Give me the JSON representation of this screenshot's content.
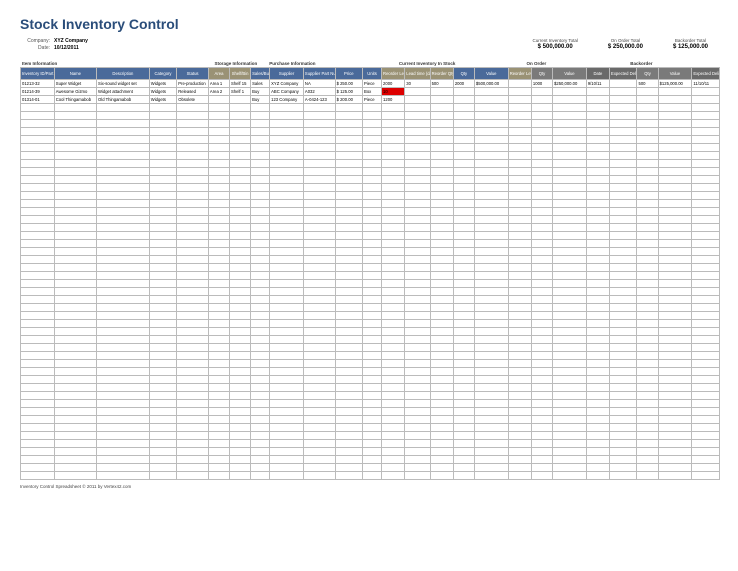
{
  "title": "Stock Inventory Control",
  "meta": {
    "company_lbl": "Company:",
    "company": "XYZ Company",
    "date_lbl": "Date:",
    "date": "10/12/2011"
  },
  "totals": {
    "inv_lbl": "Current Inventory Total",
    "inv_val": "$ 500,000.00",
    "order_lbl": "On Order Total",
    "order_val": "$ 250,000.00",
    "back_lbl": "Backorder Total",
    "back_val": "$ 125,000.00"
  },
  "sections": {
    "s1": "Item Information",
    "s2": "Storage Information",
    "s3": "Purchase Information",
    "s4": "Current Inventory In Stock",
    "s5": "On Order",
    "s6": "Backorder"
  },
  "headers": {
    "h1": "Inventory ID/Part Number",
    "h2": "Name",
    "h3": "Description",
    "h4": "Category",
    "h5": "Status",
    "h6": "Area",
    "h7": "Shelf/Bin",
    "h8": "Sales/Buy",
    "h9": "Supplier",
    "h10": "Supplier Part Number",
    "h11": "Price",
    "h12": "Units",
    "h13": "Reorder Level",
    "h14": "Lead time (days)",
    "h15": "Reorder Qty",
    "h16": "Qty",
    "h17": "Value",
    "h18": "Reorder Level",
    "h19": "Qty",
    "h20": "Value",
    "h21": "Date",
    "h22": "Expected Delivery",
    "h23": "Qty",
    "h24": "Value",
    "h25": "Expected Delivery"
  },
  "rows": [
    {
      "c1": "01213-32",
      "c2": "Super Widget",
      "c3": "Six-sound widget set",
      "c4": "Widgets",
      "c5": "Pre-production",
      "c6": "Area 1",
      "c7": "Shelf 15",
      "c8": "Sales",
      "c9": "XYZ Company",
      "c10": "NA",
      "c11": "$ 250.00",
      "c12": "Piece",
      "c13": "2000",
      "c14": "30",
      "c15": "500",
      "c16": "2000",
      "c17": "$500,000.00",
      "c18": "",
      "c19": "1000",
      "c20": "$250,000.00",
      "c21": "9/10/11",
      "c22": "",
      "c23": "500",
      "c24": "$125,000.00",
      "c25": "11/10/11"
    },
    {
      "c1": "01214-39",
      "c2": "Awesome Gizmo",
      "c3": "Widget attachment",
      "c4": "Widgets",
      "c5": "Released",
      "c6": "Area 2",
      "c7": "Shelf 1",
      "c8": "Buy",
      "c9": "ABC Company",
      "c10": "A032",
      "c11": "$ 125.00",
      "c12": "Box",
      "c13": "10",
      "c14": "",
      "c15": "",
      "c16": "",
      "c17": "",
      "c18": "",
      "c19": "",
      "c20": "",
      "c21": "",
      "c22": "",
      "c23": "",
      "c24": "",
      "c25": "",
      "red": 13
    },
    {
      "c1": "01314-01",
      "c2": "Cool Thingamabob",
      "c3": "Old Thingamabob",
      "c4": "Widgets",
      "c5": "Obsolete",
      "c6": "",
      "c7": "",
      "c8": "Buy",
      "c9": "123 Company",
      "c10": "A-0424-123",
      "c11": "$ 200.00",
      "c12": "Piece",
      "c13": "1200",
      "c14": "",
      "c15": "",
      "c16": "",
      "c17": "",
      "c18": "",
      "c19": "",
      "c20": "",
      "c21": "",
      "c22": "",
      "c23": "",
      "c24": "",
      "c25": ""
    }
  ],
  "footer": "Inventory Control Spreadsheet © 2011 by Vertex42.com"
}
